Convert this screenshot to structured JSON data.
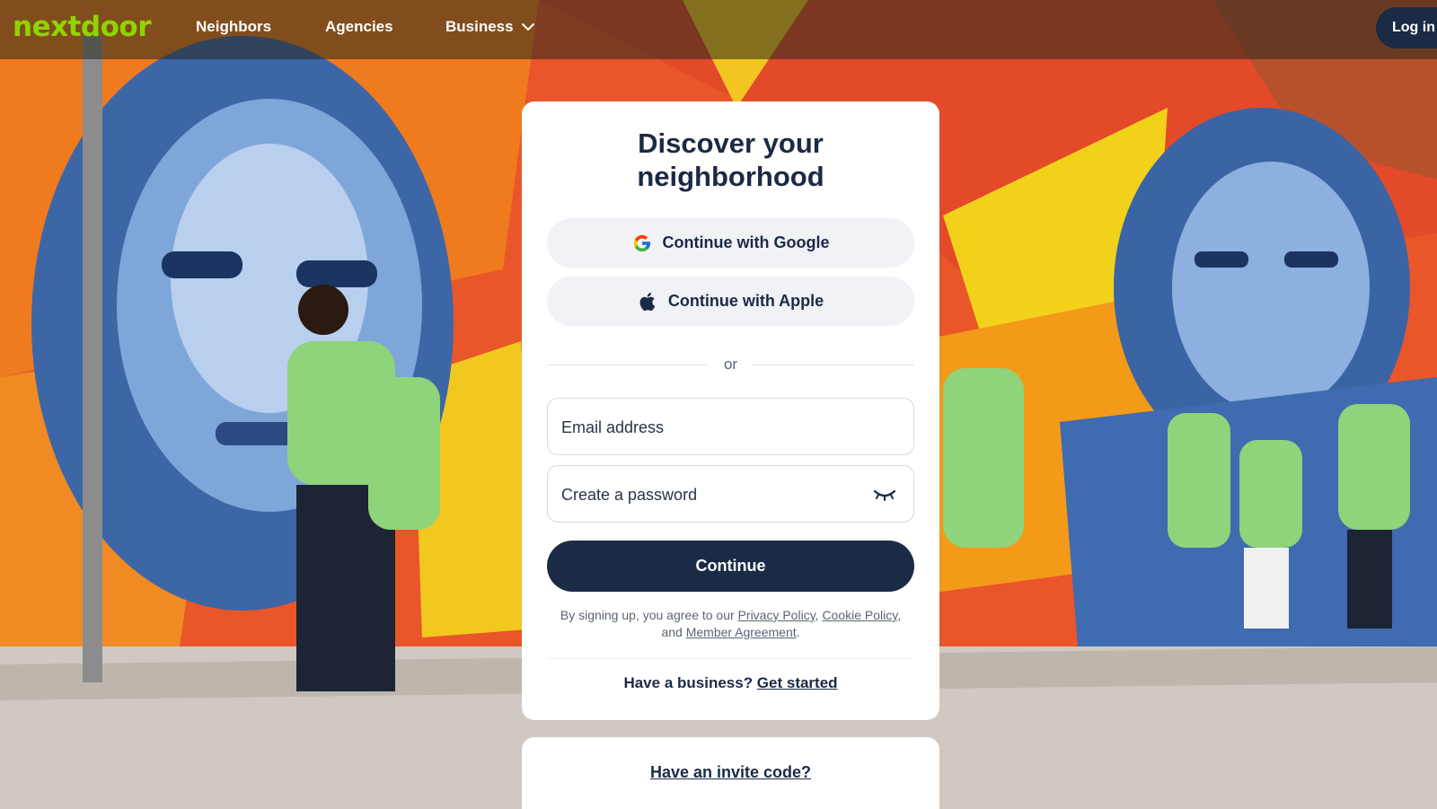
{
  "header": {
    "logo": "nextdoor",
    "nav": {
      "neighbors": "Neighbors",
      "agencies": "Agencies",
      "business": "Business"
    },
    "login": "Log in"
  },
  "signup": {
    "title_line1": "Discover your",
    "title_line2": "neighborhood",
    "google_label": "Continue with Google",
    "apple_label": "Continue with Apple",
    "divider_text": "or",
    "email_placeholder": "Email address",
    "password_placeholder": "Create a password",
    "continue_label": "Continue",
    "legal": {
      "prefix": "By signing up, you agree to our ",
      "privacy": "Privacy Policy",
      "comma": ", ",
      "cookie": "Cookie Policy",
      "comma2": ",",
      "and": "and ",
      "member": "Member Agreement",
      "period": "."
    },
    "business": {
      "question": "Have a business? ",
      "link": "Get started"
    }
  },
  "invite": {
    "link": "Have an invite code?"
  },
  "colors": {
    "brand_green": "#8ed500",
    "navy": "#1b2a45",
    "button_gray": "#f1f2f5"
  },
  "icons": {
    "google": "google-icon",
    "apple": "apple-icon",
    "eye": "eye-closed-icon",
    "chevron": "chevron-down-icon"
  }
}
